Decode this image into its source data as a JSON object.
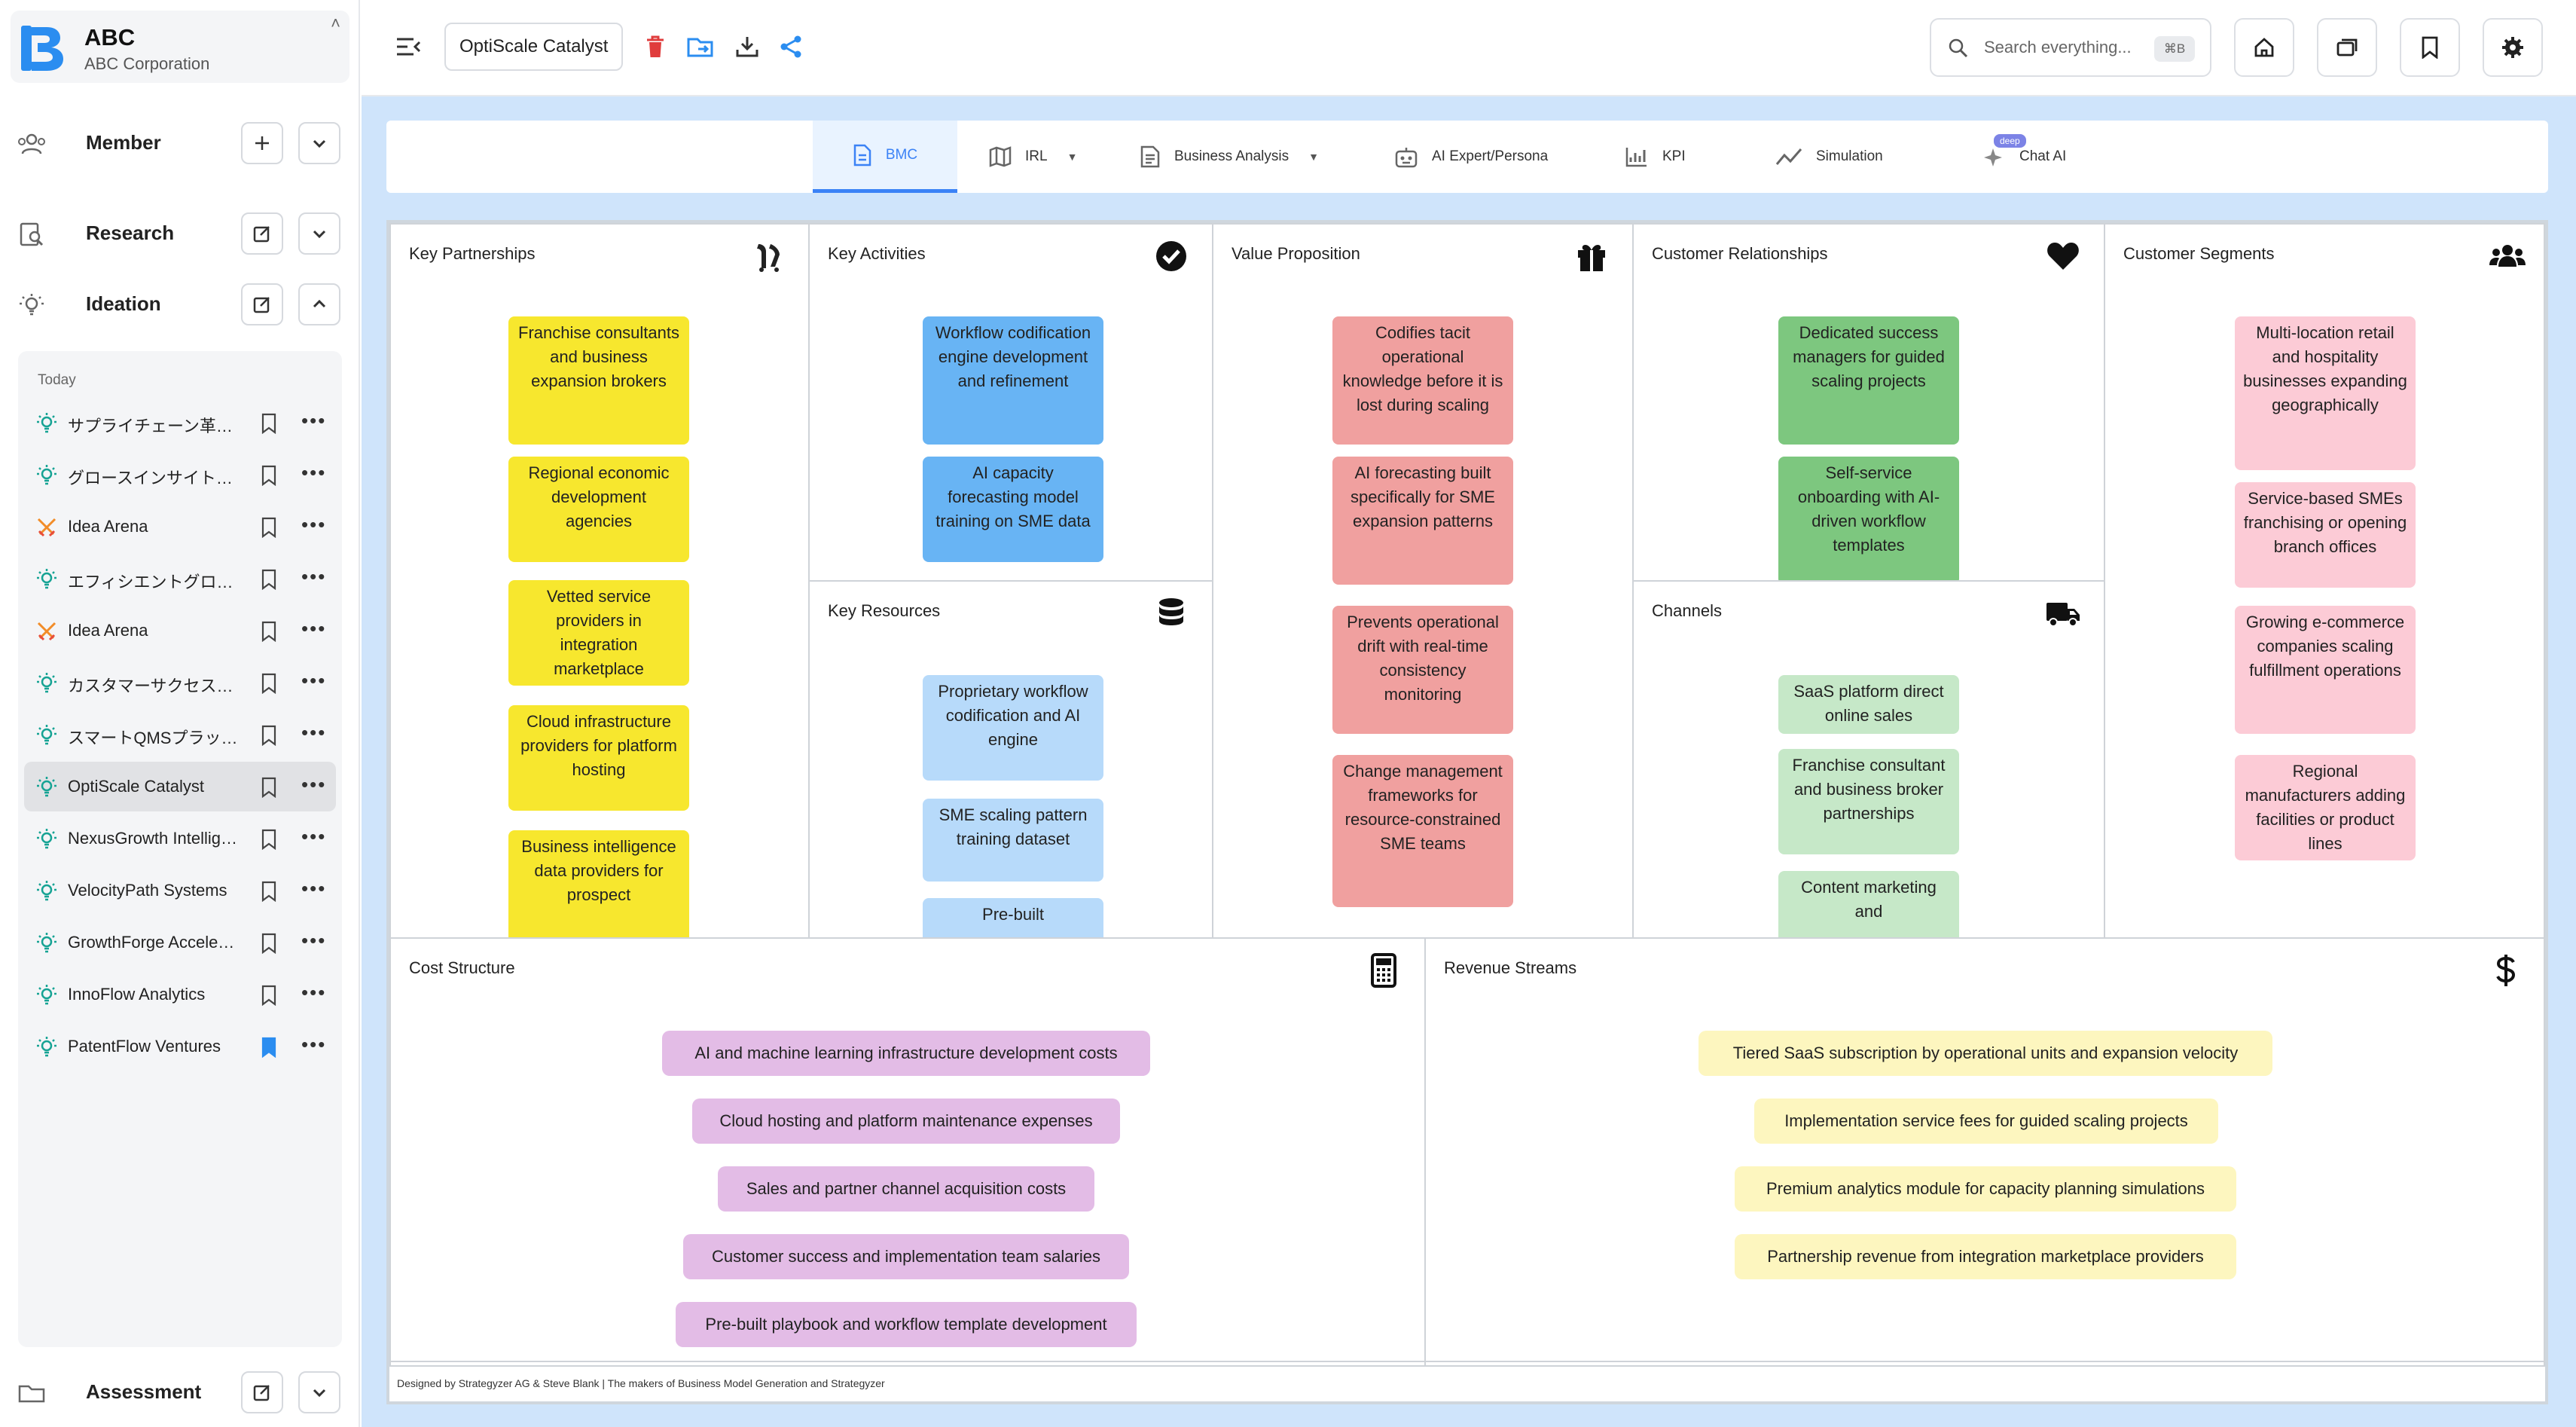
{
  "org": {
    "name": "ABC",
    "subtitle": "ABC Corporation"
  },
  "sidebar": {
    "sections": {
      "member": "Member",
      "research": "Research",
      "ideation": "Ideation",
      "assessment": "Assessment"
    },
    "today_label": "Today",
    "items": [
      {
        "label": "サプライチェーン革…",
        "icon": "bulb-icon"
      },
      {
        "label": "グロースインサイト…",
        "icon": "bulb-icon"
      },
      {
        "label": "Idea Arena",
        "icon": "swords-icon"
      },
      {
        "label": "エフィシエントグロ…",
        "icon": "bulb-icon"
      },
      {
        "label": "Idea Arena",
        "icon": "swords-icon"
      },
      {
        "label": "カスタマーサクセス…",
        "icon": "bulb-icon"
      },
      {
        "label": "スマートQMSプラッ…",
        "icon": "bulb-icon"
      },
      {
        "label": "OptiScale Catalyst",
        "icon": "bulb-icon",
        "active": true
      },
      {
        "label": "NexusGrowth Intellig…",
        "icon": "bulb-icon"
      },
      {
        "label": "VelocityPath Systems",
        "icon": "bulb-icon"
      },
      {
        "label": "GrowthForge Accele…",
        "icon": "bulb-icon"
      },
      {
        "label": "InnoFlow Analytics",
        "icon": "bulb-icon"
      },
      {
        "label": "PatentFlow Ventures",
        "icon": "bulb-icon",
        "bookmarked": true
      }
    ]
  },
  "topbar": {
    "project_name": "OptiScale Catalyst",
    "search_placeholder": "Search everything...",
    "search_shortcut": "⌘B"
  },
  "tabs": {
    "bmc": "BMC",
    "irl": "IRL",
    "business_analysis": "Business Analysis",
    "ai_expert": "AI Expert/Persona",
    "kpi": "KPI",
    "simulation": "Simulation",
    "chat_ai": "Chat AI",
    "deep_badge": "deep"
  },
  "bmc": {
    "key_partnerships": {
      "title": "Key Partnerships",
      "notes": [
        "Franchise consultants and business expansion brokers",
        "Regional economic development agencies",
        "Vetted service providers in integration marketplace",
        "Cloud infrastructure providers for platform hosting",
        "Business intelligence data providers for prospect"
      ]
    },
    "key_activities": {
      "title": "Key Activities",
      "notes": [
        "Workflow codification engine development and refinement",
        "AI capacity forecasting model training on SME data"
      ]
    },
    "key_resources": {
      "title": "Key Resources",
      "notes": [
        "Proprietary workflow codification and AI engine",
        "SME scaling pattern training dataset",
        "Pre-built"
      ]
    },
    "value_proposition": {
      "title": "Value Proposition",
      "notes": [
        "Codifies tacit operational knowledge before it is lost during scaling",
        "AI forecasting built specifically for SME expansion patterns",
        "Prevents operational drift with real-time consistency monitoring",
        "Change management frameworks for resource-constrained SME teams"
      ]
    },
    "customer_relationships": {
      "title": "Customer Relationships",
      "notes": [
        "Dedicated success managers for guided scaling projects",
        "Self-service onboarding with AI-driven workflow templates"
      ]
    },
    "channels": {
      "title": "Channels",
      "notes": [
        "SaaS platform direct online sales",
        "Franchise consultant and business broker partnerships",
        "Content marketing and"
      ]
    },
    "customer_segments": {
      "title": "Customer Segments",
      "notes": [
        "Multi-location retail and hospitality businesses expanding geographically",
        "Service-based SMEs franchising or opening branch offices",
        "Growing e-commerce companies scaling fulfillment operations",
        "Regional manufacturers adding facilities or product lines"
      ]
    },
    "cost_structure": {
      "title": "Cost Structure",
      "notes": [
        "AI and machine learning infrastructure development costs",
        "Cloud hosting and platform maintenance expenses",
        "Sales and partner channel acquisition costs",
        "Customer success and implementation team salaries",
        "Pre-built playbook and workflow template development"
      ]
    },
    "revenue_streams": {
      "title": "Revenue Streams",
      "notes": [
        "Tiered SaaS subscription by operational units and expansion velocity",
        "Implementation service fees for guided scaling projects",
        "Premium analytics module for capacity planning simulations",
        "Partnership revenue from integration marketplace providers"
      ]
    },
    "footer": "Designed by Strategyzer AG & Steve Blank | The makers of Business Model Generation and Strategyzer"
  }
}
